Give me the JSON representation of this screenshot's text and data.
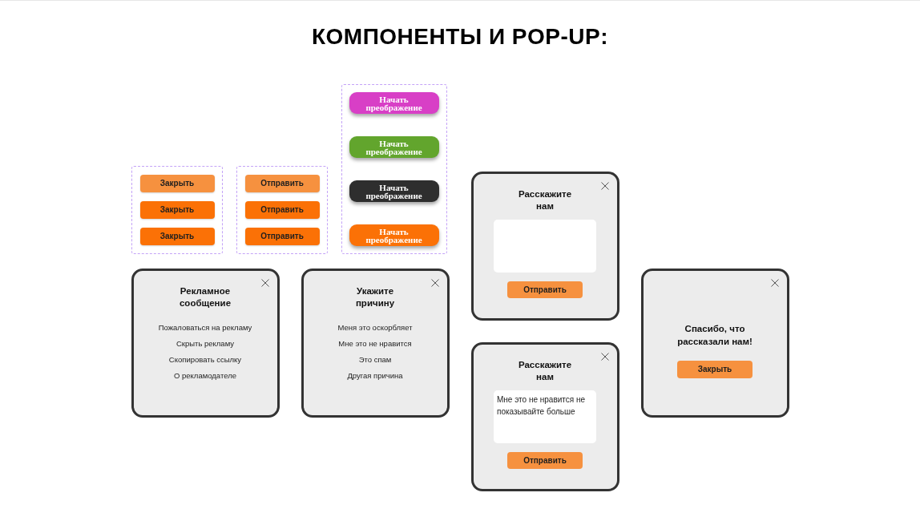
{
  "title": "КОМПОНЕНТЫ И POP-UP:",
  "button_groups": [
    {
      "kind": "plain",
      "buttons": [
        {
          "label": "Закрыть",
          "color": "#f6913f"
        },
        {
          "label": "Закрыть",
          "color": "#fb7106"
        },
        {
          "label": "Закрыть",
          "color": "#fb7106"
        }
      ]
    },
    {
      "kind": "plain",
      "buttons": [
        {
          "label": "Отправить",
          "color": "#f6913f"
        },
        {
          "label": "Отправить",
          "color": "#fb7106"
        },
        {
          "label": "Отправить",
          "color": "#fb7106"
        }
      ]
    },
    {
      "kind": "glossy",
      "buttons": [
        {
          "label": "Начать\nпреображение",
          "color": "#d83fc6"
        },
        {
          "label": "Начать\nпреображение",
          "color": "#62a52d"
        },
        {
          "label": "Начать\nпреображение",
          "color": "#2e2e2e"
        },
        {
          "label": "Начать\nпреображение",
          "color": "#fb7106"
        }
      ]
    }
  ],
  "popups": [
    {
      "kind": "menu",
      "title": "Рекламное\nсообщение",
      "items": [
        "Пожаловаться на рекламу",
        "Скрыть рекламу",
        "Скопировать ссылку",
        "О рекламодателе"
      ]
    },
    {
      "kind": "menu",
      "title": "Укажите\nпричину",
      "items": [
        "Меня это оскорбляет",
        "Мне это не нравится",
        "Это спам",
        "Другая причина"
      ]
    },
    {
      "kind": "form",
      "title": "Расскажите\nнам",
      "button": "Отправить"
    },
    {
      "kind": "form",
      "title": "Расскажите\nнам",
      "field": {
        "value": "Мне это не нравится не показывайте больше"
      },
      "button": "Отправить"
    },
    {
      "kind": "message",
      "title": "Спасибо, что\nрассказали нам!",
      "button": "Закрыть"
    }
  ]
}
